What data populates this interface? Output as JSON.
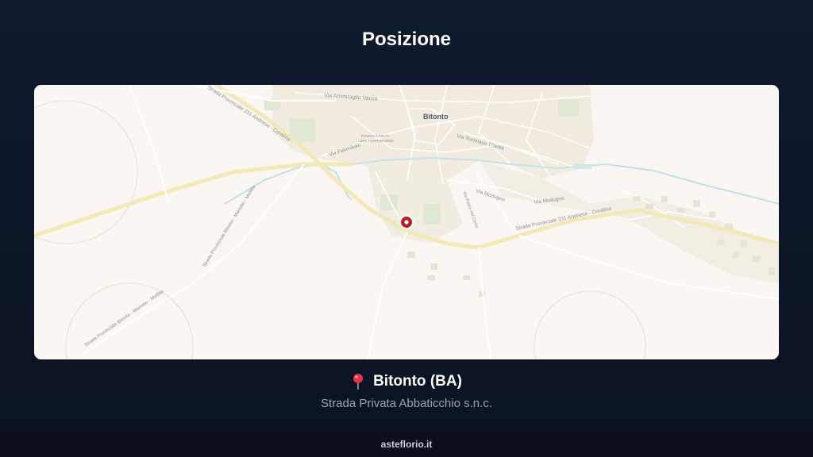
{
  "page": {
    "title": "Posizione"
  },
  "map": {
    "town_label": "Bitonto",
    "street_labels": {
      "via_ammiraglio_vacca": "Via Ammiraglio Vacca",
      "strada_provinciale_231_top": "Strada Provinciale 231 Andriese - Coratina",
      "piazza": "PIAZZA CADUTI",
      "piazza_line2": "DEL TERRORISMO",
      "via_palombaio": "Via Palombaio",
      "via_tommaso_traetta": "Via Tommaso Traetta",
      "via_modugno_1": "Via Modugno",
      "via_modugno_2": "Via Modugno",
      "via_pietro_nel_corso": "Via Pietro nel Corso",
      "strada_provinciale_231_right": "Strada Provinciale 231 Andriese - Coratina",
      "strada_bitonto_mariotto_upper": "Strada Provinciale Bitonto - Mariotto - Mellitto",
      "strada_bitonto_mariotto_lower": "Strada Provinciale Bitonto - Mariotto - Mellitto"
    },
    "marker_icon": "map-marker-icon"
  },
  "location": {
    "pin_icon": "pushpin-icon",
    "city": "Bitonto (BA)",
    "address": "Strada Privata Abbaticchio s.n.c."
  },
  "footer": {
    "site": "asteflorio.it"
  },
  "colors": {
    "background": "#0e1729",
    "map_land": "#faf6f1",
    "road_major": "#f3e9b8",
    "water": "#bfe3e6",
    "marker": "#b3202a"
  }
}
